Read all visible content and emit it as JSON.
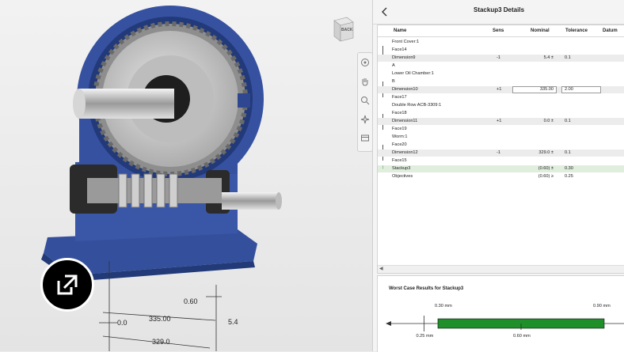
{
  "viewport": {
    "viewcube_label": "BACK",
    "dimensions": [
      "0.60",
      "335.00",
      "0.0",
      "5.4",
      "329.0"
    ],
    "tools": [
      "orbit-icon",
      "pan-icon",
      "zoom-icon",
      "measure-icon",
      "display-icon"
    ]
  },
  "panel": {
    "title": "Stackup3 Details",
    "columns": [
      "Name",
      "Sens",
      "Nominal",
      "Tolerance",
      "Datum"
    ],
    "rows": [
      {
        "name": "Front Cover:1",
        "sens": "",
        "nominal": "",
        "tol": ""
      },
      {
        "name": "Face14",
        "sens": "",
        "nominal": "",
        "tol": ""
      },
      {
        "name": "Dimension9",
        "sens": "-1",
        "nominal": "5.4 ±",
        "tol": "0.1"
      },
      {
        "name": "A",
        "sens": "",
        "nominal": "",
        "tol": ""
      },
      {
        "name": "Lower Oil Chamber:1",
        "sens": "",
        "nominal": "",
        "tol": ""
      },
      {
        "name": "B",
        "sens": "",
        "nominal": "",
        "tol": ""
      },
      {
        "name": "Dimension10",
        "sens": "+1",
        "nominal": "335.00",
        "tol": "2.00"
      },
      {
        "name": "Face17",
        "sens": "",
        "nominal": "",
        "tol": ""
      },
      {
        "name": "Double Row ACB-3309:1",
        "sens": "",
        "nominal": "",
        "tol": ""
      },
      {
        "name": "Face18",
        "sens": "",
        "nominal": "",
        "tol": ""
      },
      {
        "name": "Dimension11",
        "sens": "+1",
        "nominal": "0.0 ±",
        "tol": "0.1"
      },
      {
        "name": "Face19",
        "sens": "",
        "nominal": "",
        "tol": ""
      },
      {
        "name": "Worm:1",
        "sens": "",
        "nominal": "",
        "tol": ""
      },
      {
        "name": "Face20",
        "sens": "",
        "nominal": "",
        "tol": ""
      },
      {
        "name": "Dimension12",
        "sens": "-1",
        "nominal": "329.0 ±",
        "tol": "0.1"
      },
      {
        "name": "Face15",
        "sens": "",
        "nominal": "",
        "tol": ""
      },
      {
        "name": "Stackup3",
        "sens": "",
        "nominal": "(0.60) ±",
        "tol": "0.30"
      },
      {
        "name": "Objectives",
        "sens": "",
        "nominal": "(0.60) ≥",
        "tol": "0.25"
      }
    ]
  },
  "results": {
    "title": "Worst Case Results for Stackup3",
    "min_label": "0.30 mm",
    "max_label": "0.90 mm",
    "objective_label": "0.25 mm",
    "nominal_label": "0.60 mm",
    "range_min": 0.3,
    "range_max": 0.9,
    "bar_color": "#1f8f2a"
  },
  "colors": {
    "housing": "#3b56a4",
    "gear": "#c9c9c9"
  }
}
